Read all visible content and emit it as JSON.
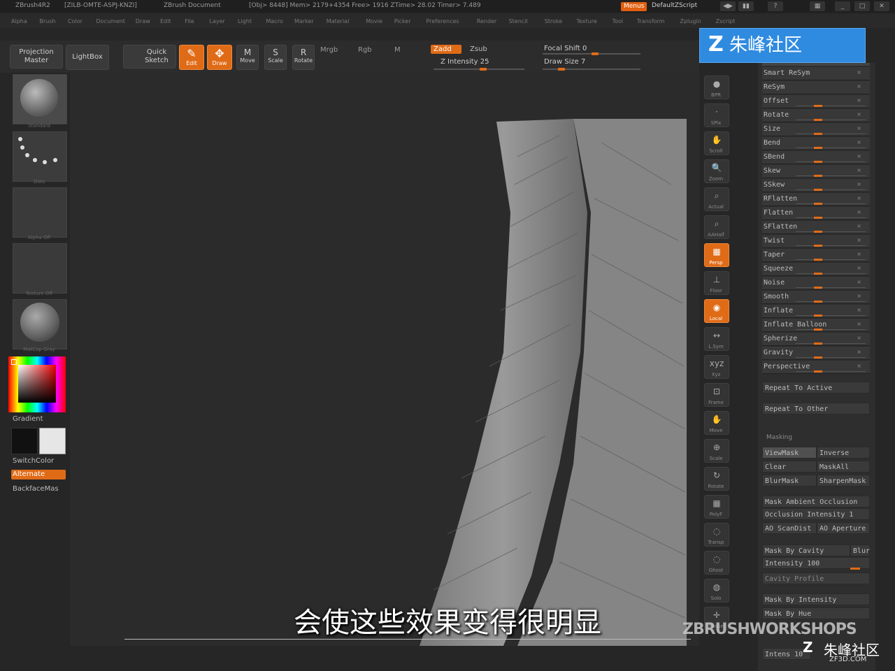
{
  "title": {
    "app": "ZBrush4R2",
    "serial": "[ZILB-OMTE-ASPJ-KNZI]",
    "document": "ZBrush Document",
    "stats": "[Obj> 8448] Mem> 2179+4354 Free> 1916 ZTime> 28.02 Timer> 7.489",
    "menus": "Menus",
    "script": "DefaultZScript"
  },
  "menubar": [
    "Alpha",
    "Brush",
    "Color",
    "Document",
    "Draw",
    "Edit",
    "File",
    "Layer",
    "Light",
    "Macro",
    "Marker",
    "Material",
    "Movie",
    "Picker",
    "Preferences",
    "Render",
    "Stencil",
    "Stroke",
    "Texture",
    "Tool",
    "Transform",
    "Zplugin",
    "Zscript"
  ],
  "shelf": {
    "projection": "Projection\nMaster",
    "lightbox": "LightBox",
    "quick_sketch": "Quick\nSketch",
    "edit": "Edit",
    "draw": "Draw",
    "move": "Move",
    "scale": "Scale",
    "rotate": "Rotate",
    "mrgb": "Mrgb",
    "rgb": "Rgb",
    "m": "M",
    "zadd": "Zadd",
    "zsub": "Zsub",
    "z_intensity": "Z Intensity 25",
    "focal_shift": "Focal Shift 0",
    "draw_size": "Draw Size 7"
  },
  "left": {
    "thumb1": "Standard",
    "thumb2": "Dots",
    "thumb3": "Alpha Off",
    "thumb4": "Texture Off",
    "thumb5": "MatCap Gray",
    "gradient": "Gradient",
    "switchcolor": "SwitchColor",
    "alternate": "Alternate",
    "backface": "BackfaceMas"
  },
  "rtools": [
    "BPR",
    "SPix",
    "Scroll",
    "Zoom",
    "Actual",
    "AAHalf",
    "Persp",
    "Floor",
    "Local",
    "L.Sym",
    "Xyz",
    "Frame",
    "Move",
    "Scale",
    "Rotate",
    "PolyF",
    "Transp",
    "Ghost",
    "Solo",
    "Xpose"
  ],
  "deformation": [
    "Smart ReSym",
    "ReSym",
    "Offset",
    "Rotate",
    "Size",
    "Bend",
    "SBend",
    "Skew",
    "SSkew",
    "RFlatten",
    "Flatten",
    "SFlatten",
    "Twist",
    "Taper",
    "Squeeze",
    "Noise",
    "Smooth",
    "Inflate",
    "Inflate Balloon",
    "Spherize",
    "Gravity",
    "Perspective"
  ],
  "repeat_active": "Repeat To Active",
  "repeat_other": "Repeat To Other",
  "masking": {
    "header": "Masking",
    "viewmask": "ViewMask",
    "inverse": "Inverse",
    "clear": "Clear",
    "maskall": "MaskAll",
    "blurmask": "BlurMask",
    "sharpenmask": "SharpenMask",
    "ambient": "Mask Ambient Occlusion",
    "occ_intensity": "Occlusion Intensity 1",
    "ao_scandist": "AO ScanDist",
    "ao_aperture": "AO Aperture",
    "by_cavity": "Mask By Cavity",
    "blur": "Blur",
    "intensity": "Intensity 100",
    "cavity_profile": "Cavity Profile",
    "by_intensity": "Mask By Intensity",
    "by_hue": "Mask By Hue",
    "intens": "Intens 10"
  },
  "watermark_top": "朱峰社区",
  "watermark_zbw": "ZBRUSHWORKSHOPS",
  "watermark_br": "朱峰社区",
  "watermark_br_url": "ZF3D.COM",
  "subtitle": "会使这些效果变得很明显"
}
